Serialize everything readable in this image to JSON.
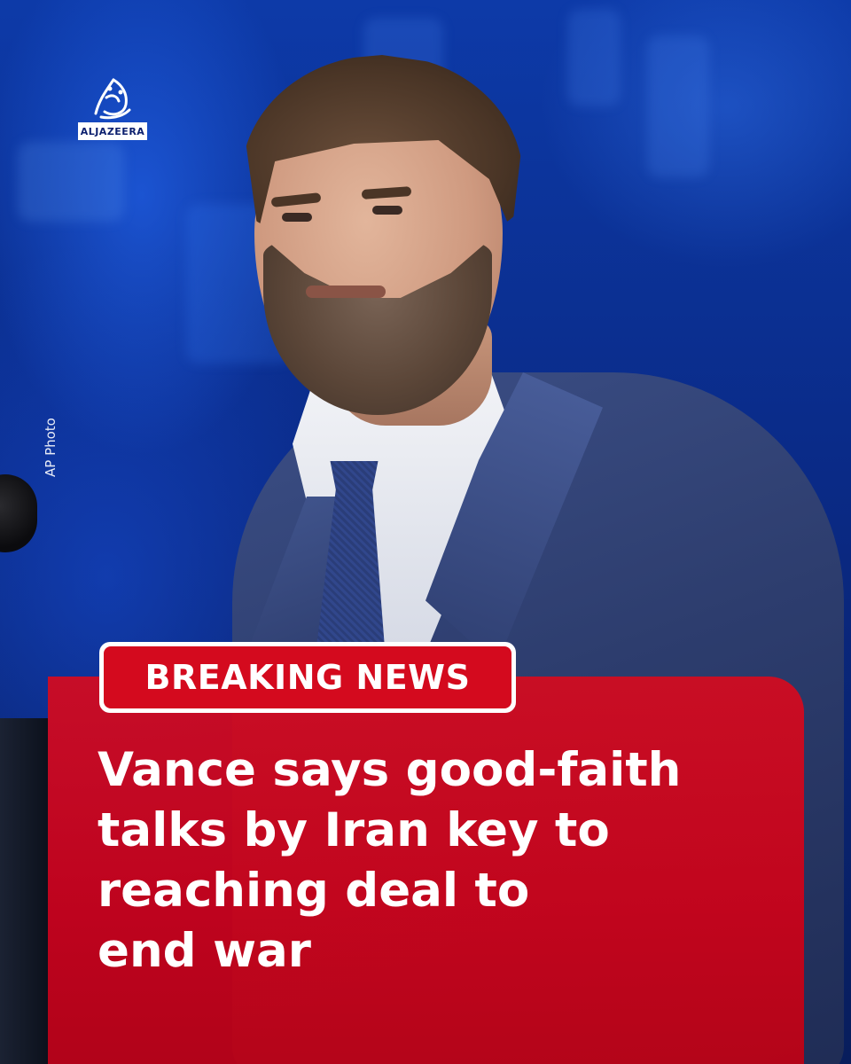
{
  "brand": {
    "logo_text": "ALJAZEERA",
    "logo_icon": "al-jazeera-calligraphy-logo"
  },
  "photo": {
    "credit": "AP Photo"
  },
  "badge": {
    "label": "BREAKING NEWS"
  },
  "headline": {
    "lines": [
      "Vance says good-faith",
      "talks by Iran key to",
      "reaching deal to",
      "end war"
    ]
  },
  "colors": {
    "accent_red": "#d40a1e",
    "background_blue": "#0a2a86",
    "text_white": "#ffffff"
  }
}
